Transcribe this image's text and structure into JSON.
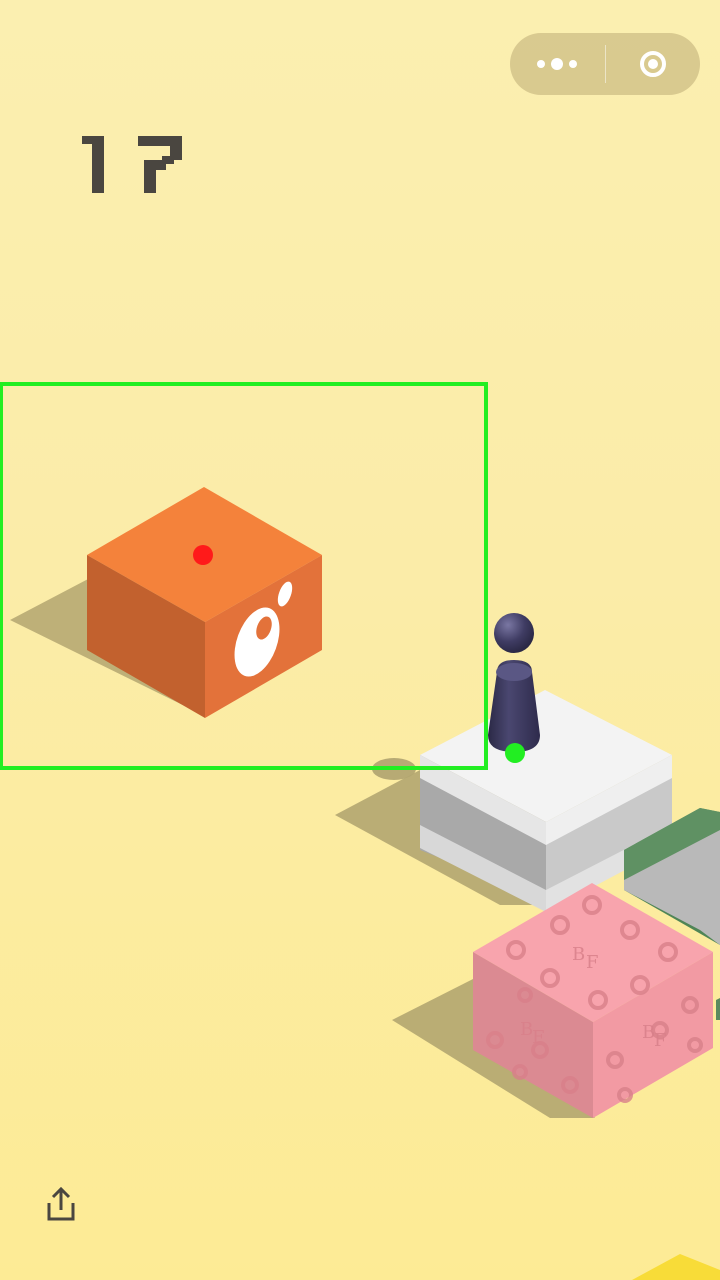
{
  "game": {
    "score": "17"
  },
  "capsule": {
    "more_icon": "more-dots-icon",
    "close_icon": "target-circle-icon"
  },
  "share": {
    "icon": "share-upload-icon"
  },
  "colors": {
    "background": "#fbeca8",
    "highlight_box": "#22ee22",
    "target_marker": "#ff1a1a",
    "player_marker": "#22ee22",
    "player": "#3d3a5e"
  }
}
